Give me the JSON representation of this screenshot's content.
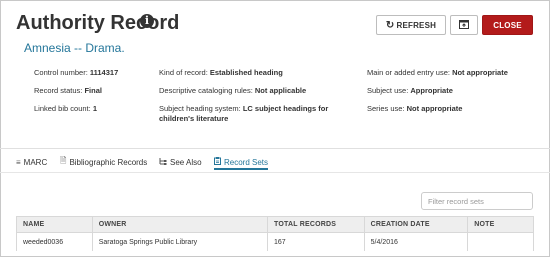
{
  "header": {
    "title": "Authority Record",
    "info_icon_glyph": "i",
    "heading": "Amnesia -- Drama."
  },
  "buttons": {
    "refresh_label": "REFRESH",
    "refresh_icon": "refresh-icon",
    "popout_icon": "popout-icon",
    "close_label": "CLOSE",
    "close_color": "#b31b1b"
  },
  "details": {
    "control_number": {
      "label": "Control number:",
      "value": "1114317"
    },
    "record_status": {
      "label": "Record status:",
      "value": "Final"
    },
    "linked_bib_count": {
      "label": "Linked bib count:",
      "value": "1"
    },
    "kind_of_record": {
      "label": "Kind of record:",
      "value": "Established heading"
    },
    "descriptive_rules": {
      "label": "Descriptive cataloging rules:",
      "value": "Not applicable"
    },
    "subject_heading_system": {
      "label": "Subject heading system:",
      "value": "LC subject headings for children's literature"
    },
    "main_entry_use": {
      "label": "Main or added entry use:",
      "value": "Not appropriate"
    },
    "subject_use": {
      "label": "Subject use:",
      "value": "Appropriate"
    },
    "series_use": {
      "label": "Series use:",
      "value": "Not appropriate"
    }
  },
  "tabs": [
    {
      "label": "MARC",
      "icon": "list-icon",
      "active": false
    },
    {
      "label": "Bibliographic Records",
      "icon": "document-icon",
      "active": false
    },
    {
      "label": "See Also",
      "icon": "tree-icon",
      "active": false
    },
    {
      "label": "Record Sets",
      "icon": "clipboard-icon",
      "active": true
    }
  ],
  "record_sets": {
    "filter_placeholder": "Filter record sets",
    "columns": [
      "NAME",
      "OWNER",
      "TOTAL RECORDS",
      "CREATION DATE",
      "NOTE"
    ],
    "rows": [
      [
        "weeded0036",
        "Saratoga Springs Public Library",
        "167",
        "5/4/2016",
        ""
      ]
    ]
  },
  "colors": {
    "accent": "#24769a",
    "close_button": "#b31b1b"
  }
}
